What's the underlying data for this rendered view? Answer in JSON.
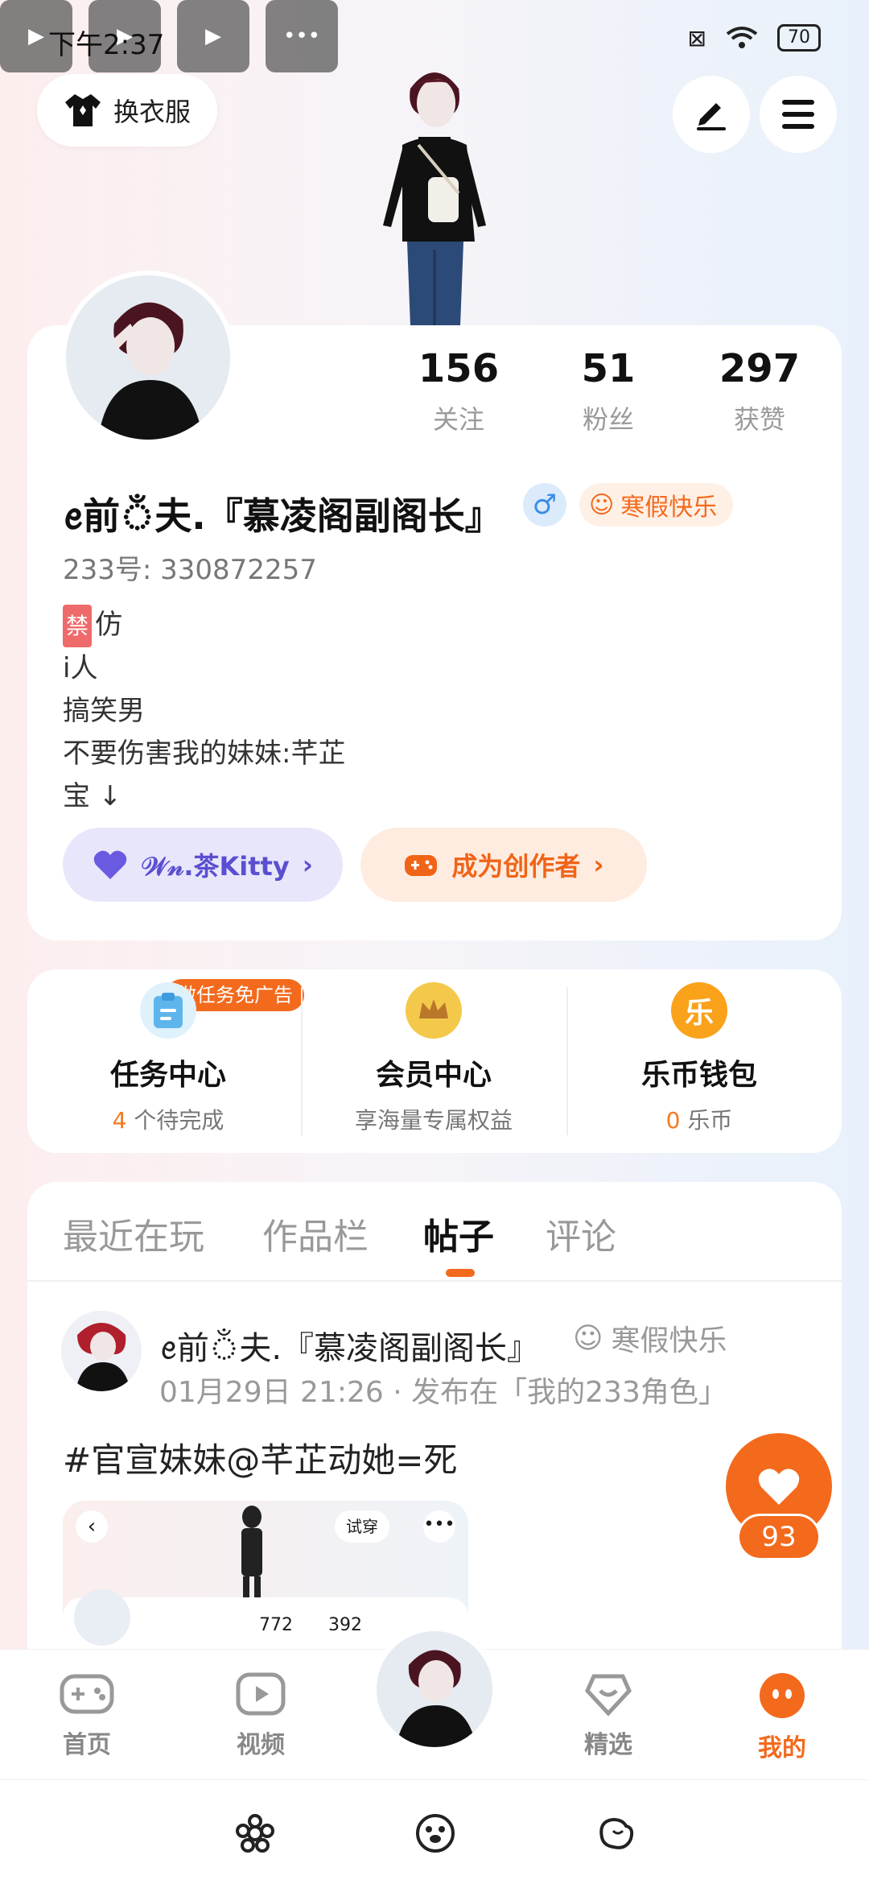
{
  "status_bar": {
    "time": "下午2:37",
    "battery": "70"
  },
  "header": {
    "dress_label": "换衣服"
  },
  "profile": {
    "stats": [
      {
        "num": "156",
        "label": "关注"
      },
      {
        "num": "51",
        "label": "粉丝"
      },
      {
        "num": "297",
        "label": "获赞"
      }
    ],
    "nickname": "ꫀ前ঁ夫.『慕凌阁副阁长』",
    "gender_symbol": "♂",
    "badge": "寒假快乐",
    "uid": "233号: 330872257",
    "bio": {
      "ban": "禁",
      "line1": "仿",
      "line2": "i人",
      "line3": "搞笑男",
      "line4": "不要伤害我的妹妹:芊芷",
      "line5": "宝 ↓"
    },
    "kitty_label": "𝒲𝓃.茶Kitty",
    "creator_label": "成为创作者"
  },
  "functions": [
    {
      "title": "任务中心",
      "count": "4",
      "sub": " 个待完成",
      "tag": "做任务免广告"
    },
    {
      "title": "会员中心",
      "sub": "享海量专属权益"
    },
    {
      "title": "乐币钱包",
      "count": "0",
      "sub": " 乐币",
      "icon_text": "乐"
    }
  ],
  "tabs": [
    "最近在玩",
    "作品栏",
    "帖子",
    "评论"
  ],
  "post": {
    "author": "ꫀ前ঁ夫.『慕凌阁副阁长』",
    "badge": "寒假快乐",
    "meta": "01月29日 21:26 · 发布在「我的233角色」",
    "text": "#官宣妹妹@芊芷动她=死",
    "image_tag": "试穿",
    "image_stat1": "772",
    "image_stat2": "392",
    "likes": "93"
  },
  "nav": {
    "home": "首页",
    "video": "视频",
    "featured": "精选",
    "mine": "我的"
  },
  "colors": {
    "accent": "#f36a1d",
    "kitty": "#5a4fd0"
  }
}
